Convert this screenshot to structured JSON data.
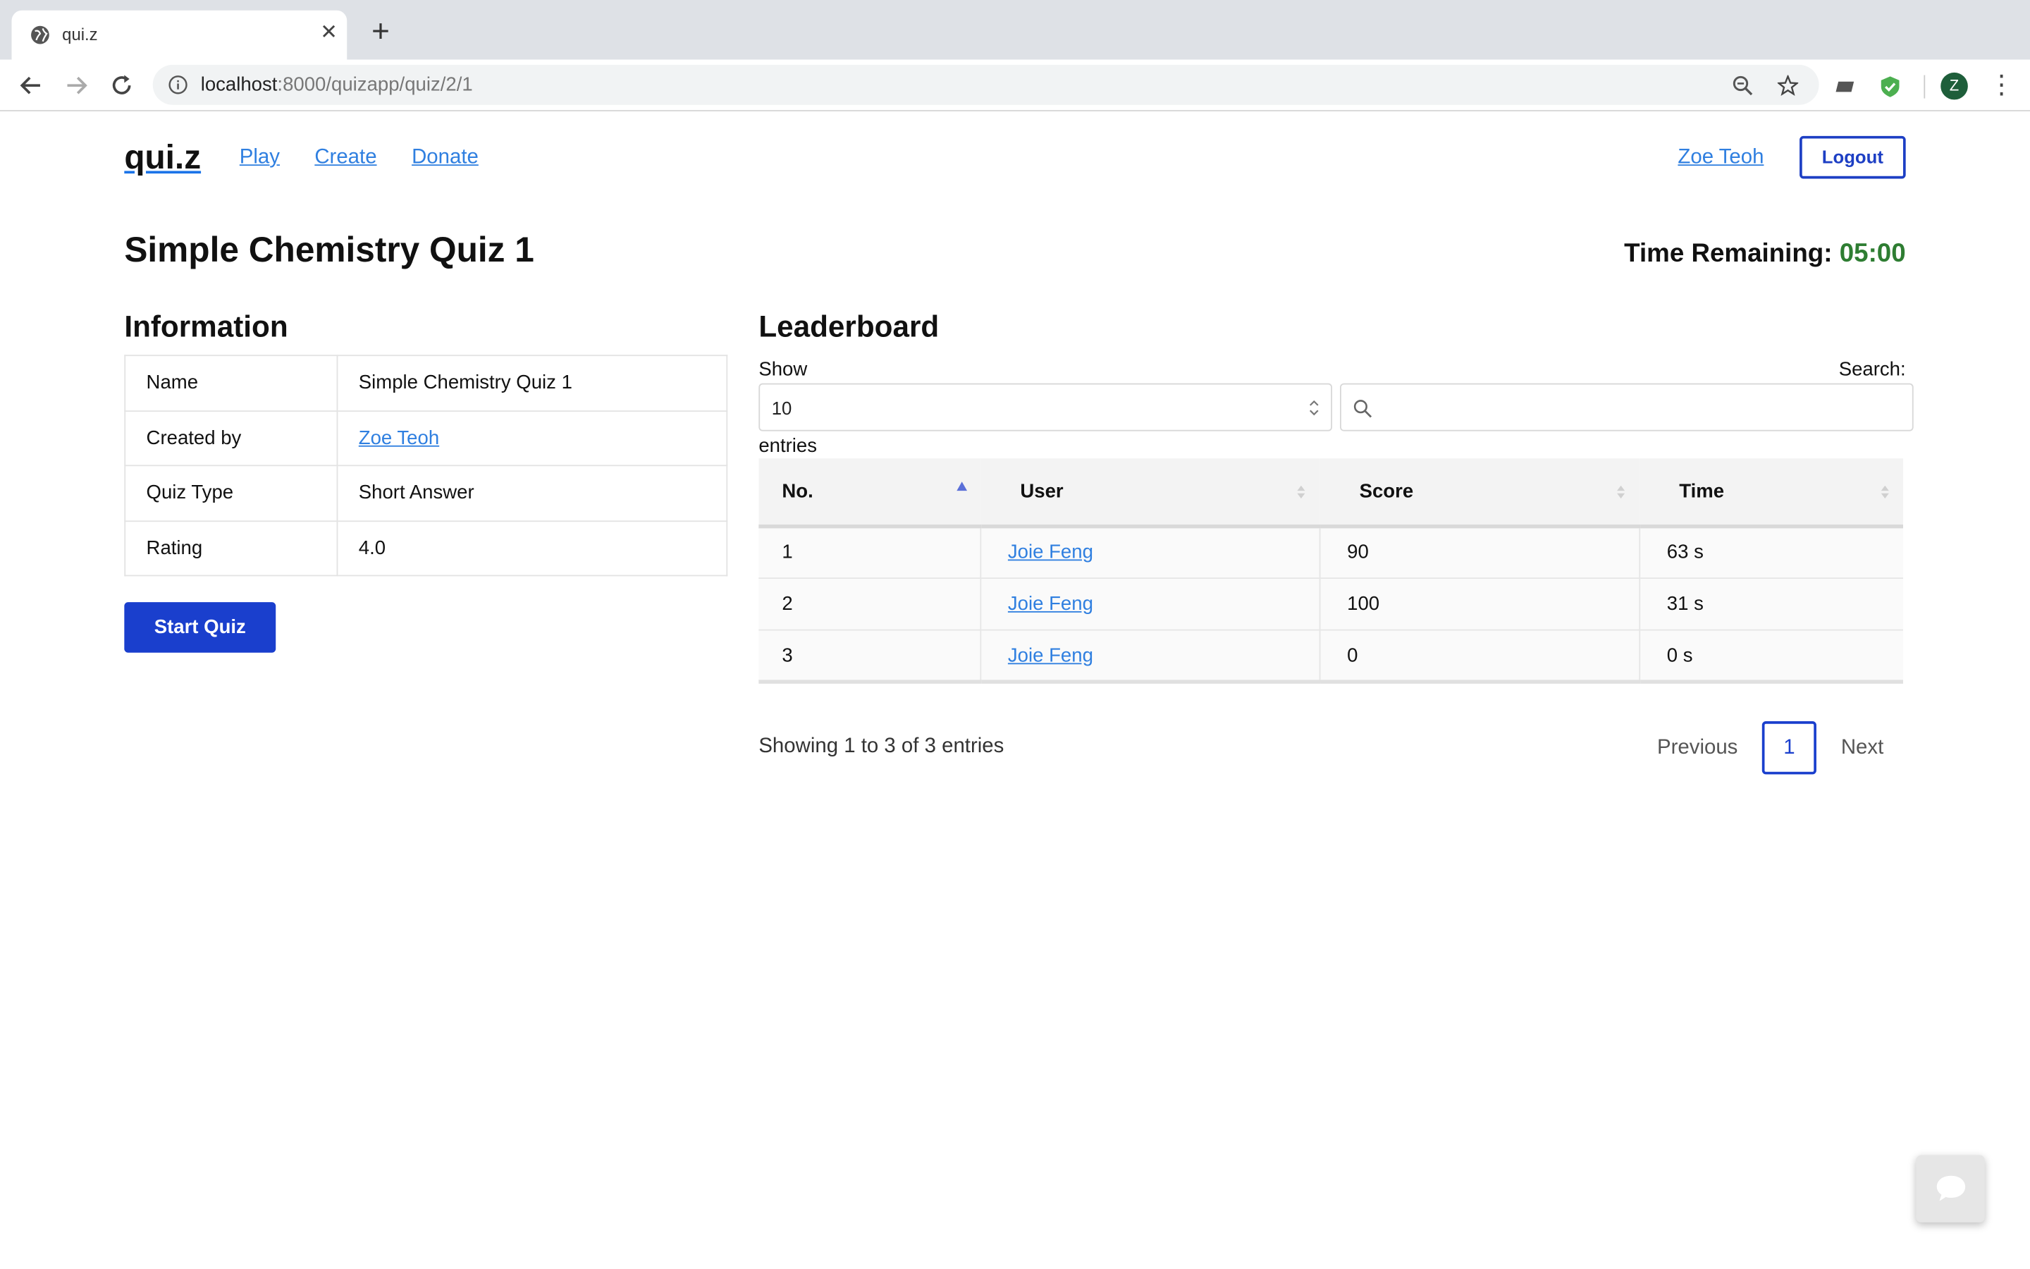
{
  "browser": {
    "tab_title": "qui.z",
    "url_host": "localhost",
    "url_rest": ":8000/quizapp/quiz/2/1",
    "profile_initial": "Z"
  },
  "nav": {
    "brand": "qui.z",
    "links": [
      "Play",
      "Create",
      "Donate"
    ],
    "user": "Zoe Teoh",
    "logout": "Logout"
  },
  "quiz": {
    "title": "Simple Chemistry Quiz 1",
    "time_label": "Time Remaining:",
    "time_value": "05:00"
  },
  "information": {
    "heading": "Information",
    "rows": [
      {
        "key": "Name",
        "value": "Simple Chemistry Quiz 1"
      },
      {
        "key": "Created by",
        "value": "Zoe Teoh"
      },
      {
        "key": "Quiz Type",
        "value": "Short Answer"
      },
      {
        "key": "Rating",
        "value": "4.0"
      }
    ],
    "start_button": "Start Quiz"
  },
  "leaderboard": {
    "heading": "Leaderboard",
    "show_label": "Show",
    "page_size": "10",
    "entries_label": "entries",
    "search_label": "Search:",
    "search_value": "",
    "columns": [
      "No.",
      "User",
      "Score",
      "Time"
    ],
    "rows": [
      {
        "no": "1",
        "user": "Joie Feng",
        "score": "90",
        "time": "63 s"
      },
      {
        "no": "2",
        "user": "Joie Feng",
        "score": "100",
        "time": "31 s"
      },
      {
        "no": "3",
        "user": "Joie Feng",
        "score": "0",
        "time": "0 s"
      }
    ],
    "summary": "Showing 1 to 3 of 3 entries",
    "pagination": {
      "previous": "Previous",
      "current": "1",
      "next": "Next"
    }
  },
  "colors": {
    "accent": "#1a3fcd",
    "link": "#2f7fe0",
    "positive": "#2e7d32"
  }
}
